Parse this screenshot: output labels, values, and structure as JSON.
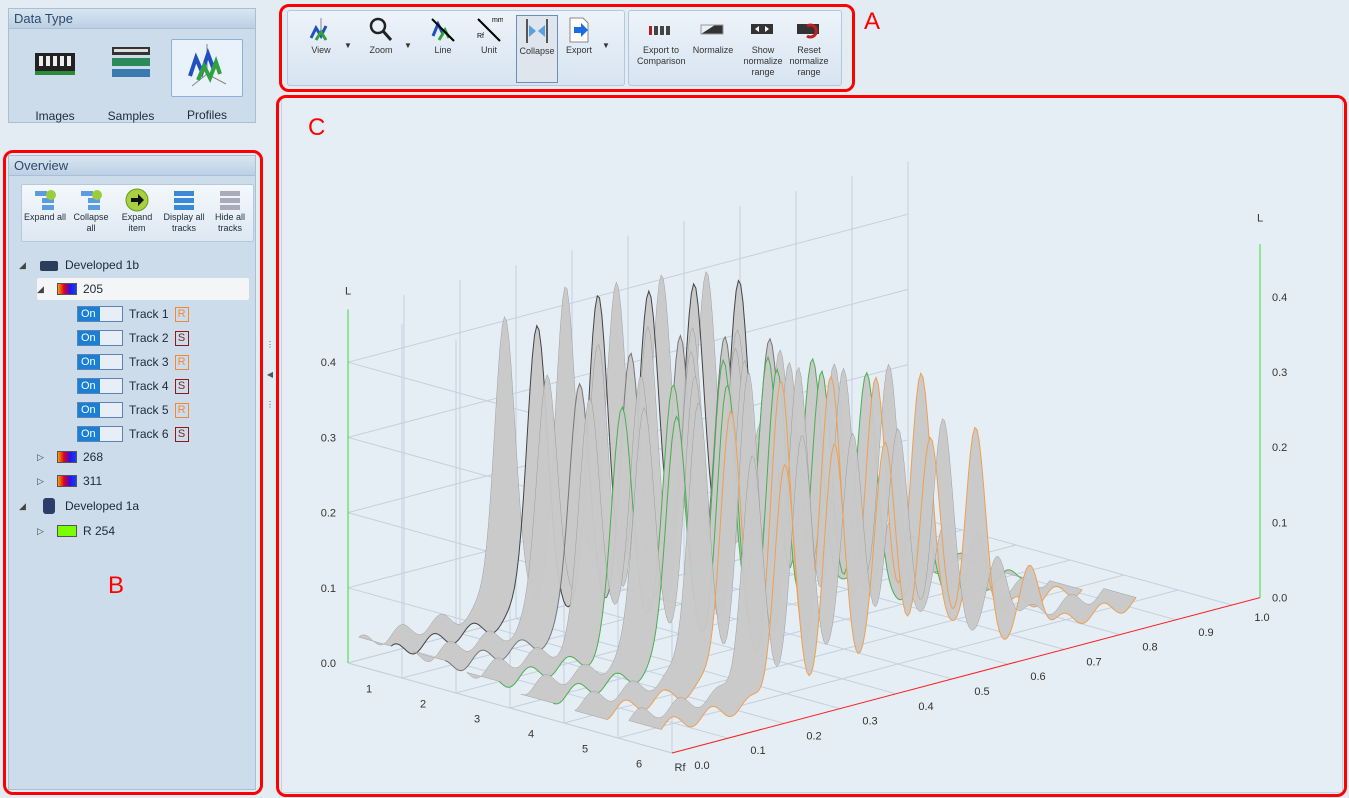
{
  "data_type": {
    "title": "Data Type",
    "items": [
      {
        "label": "Images",
        "icon": "images-icon"
      },
      {
        "label": "Samples",
        "icon": "samples-icon"
      },
      {
        "label": "Profiles",
        "icon": "profiles-icon",
        "selected": true
      }
    ]
  },
  "overview": {
    "title": "Overview",
    "toolbar": [
      {
        "label": "Expand all",
        "icon": "expand-all-icon"
      },
      {
        "label": "Collapse all",
        "icon": "collapse-all-icon"
      },
      {
        "label": "Expand item",
        "icon": "expand-item-icon"
      },
      {
        "label": "Display all tracks",
        "icon": "display-all-tracks-icon"
      },
      {
        "label": "Hide all tracks",
        "icon": "hide-all-tracks-icon"
      }
    ],
    "tree": {
      "dev1b": {
        "label": "Developed 1b",
        "children": {
          "c205": "205",
          "c268": "268",
          "c311": "311"
        }
      },
      "tracks": [
        {
          "label": "Track 1",
          "toggle": "On",
          "badge": "R"
        },
        {
          "label": "Track 2",
          "toggle": "On",
          "badge": "S"
        },
        {
          "label": "Track 3",
          "toggle": "On",
          "badge": "R"
        },
        {
          "label": "Track 4",
          "toggle": "On",
          "badge": "S"
        },
        {
          "label": "Track 5",
          "toggle": "On",
          "badge": "R"
        },
        {
          "label": "Track 6",
          "toggle": "On",
          "badge": "S"
        }
      ],
      "dev1a": {
        "label": "Developed 1a",
        "children": {
          "r254": "R 254"
        }
      }
    }
  },
  "toolbar": {
    "group1": [
      {
        "label": "View",
        "icon": "view-icon",
        "dropdown": true
      },
      {
        "label": "Zoom",
        "icon": "zoom-icon",
        "dropdown": true
      },
      {
        "label": "Line",
        "icon": "line-icon"
      },
      {
        "label": "Unit",
        "icon": "unit-icon"
      },
      {
        "label": "Collapse",
        "icon": "collapse-icon",
        "active": true
      },
      {
        "label": "Export",
        "icon": "export-icon",
        "dropdown": true
      }
    ],
    "group2": [
      {
        "label": "Export to Comparison",
        "icon": "export-comparison-icon"
      },
      {
        "label": "Normalize",
        "icon": "normalize-icon"
      },
      {
        "label": "Show normalize range",
        "icon": "show-range-icon"
      },
      {
        "label": "Reset normalize range",
        "icon": "reset-range-icon"
      }
    ]
  },
  "annotations": {
    "A": "A",
    "B": "B",
    "C": "C"
  },
  "colors": {
    "annotation": "#ff0000",
    "rf_axis": "#ff2020",
    "l_axis": "#33dd33",
    "toggle_on": "#1b7fd4",
    "badge_R": "#f08a30",
    "badge_S": "#8b1a1a"
  },
  "plot": {
    "left_axis_title": "L",
    "right_axis_title": "L",
    "rf_axis_title": "Rf",
    "l_ticks": [
      "0.0",
      "0.1",
      "0.2",
      "0.3",
      "0.4"
    ],
    "rf_ticks": [
      "0.0",
      "0.1",
      "0.2",
      "0.3",
      "0.4",
      "0.5",
      "0.6",
      "0.7",
      "0.8",
      "0.9",
      "1.0"
    ],
    "track_ticks": [
      "1",
      "2",
      "3",
      "4",
      "5",
      "6"
    ],
    "tracks": [
      {
        "track": 1,
        "color": "#444444",
        "peaks": [
          [
            0.26,
            0.42
          ],
          [
            0.37,
            0.43
          ],
          [
            0.46,
            0.43
          ],
          [
            0.54,
            0.42
          ],
          [
            0.62,
            0.4
          ],
          [
            0.72,
            0.18
          ]
        ]
      },
      {
        "track": 2,
        "color": "#777777",
        "peaks": [
          [
            0.24,
            0.37
          ],
          [
            0.33,
            0.38
          ],
          [
            0.42,
            0.38
          ],
          [
            0.5,
            0.37
          ],
          [
            0.58,
            0.36
          ],
          [
            0.68,
            0.12
          ]
        ]
      },
      {
        "track": 3,
        "color": "#4caf50",
        "peaks": [
          [
            0.22,
            0.36
          ],
          [
            0.31,
            0.37
          ],
          [
            0.4,
            0.37
          ],
          [
            0.48,
            0.36
          ],
          [
            0.56,
            0.35
          ],
          [
            0.66,
            0.12
          ]
        ]
      },
      {
        "track": 4,
        "color": "#4caf50",
        "peaks": [
          [
            0.22,
            0.37
          ],
          [
            0.31,
            0.38
          ],
          [
            0.4,
            0.38
          ],
          [
            0.48,
            0.37
          ],
          [
            0.56,
            0.36
          ],
          [
            0.66,
            0.12
          ]
        ]
      },
      {
        "track": 5,
        "color": "#f0a050",
        "peaks": [
          [
            0.22,
            0.39
          ],
          [
            0.31,
            0.4
          ],
          [
            0.4,
            0.4
          ],
          [
            0.48,
            0.39
          ],
          [
            0.56,
            0.38
          ],
          [
            0.66,
            0.13
          ]
        ]
      },
      {
        "track": 6,
        "color": "#f0a050",
        "peaks": [
          [
            0.22,
            0.33
          ],
          [
            0.31,
            0.34
          ],
          [
            0.4,
            0.34
          ],
          [
            0.48,
            0.33
          ],
          [
            0.56,
            0.32
          ],
          [
            0.66,
            0.11
          ]
        ]
      }
    ]
  }
}
